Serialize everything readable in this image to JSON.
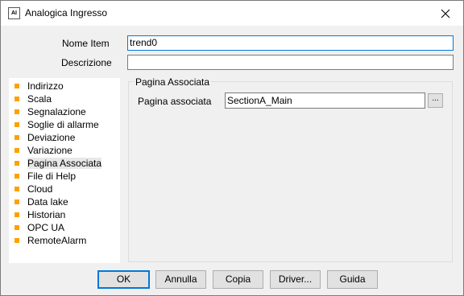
{
  "window": {
    "title": "Analogica Ingresso",
    "icon_label": "AI"
  },
  "form": {
    "name_label": "Nome Item",
    "name_value": "trend0",
    "description_label": "Descrizione",
    "description_value": ""
  },
  "sidebar": {
    "items": [
      {
        "label": "Indirizzo"
      },
      {
        "label": "Scala"
      },
      {
        "label": "Segnalazione"
      },
      {
        "label": "Soglie di allarme"
      },
      {
        "label": "Deviazione"
      },
      {
        "label": "Variazione"
      },
      {
        "label": "Pagina Associata",
        "selected": true
      },
      {
        "label": "File di Help"
      },
      {
        "label": "Cloud"
      },
      {
        "label": "Data lake"
      },
      {
        "label": "Historian"
      },
      {
        "label": "OPC UA"
      },
      {
        "label": "RemoteAlarm"
      }
    ],
    "bullet_color": "#ffa000"
  },
  "panel": {
    "group_title": "Pagina Associata",
    "page_label": "Pagina associata",
    "page_value": "SectionA_Main",
    "browse_label": "..."
  },
  "buttons": {
    "ok": "OK",
    "cancel": "Annulla",
    "copy": "Copia",
    "driver": "Driver...",
    "help": "Guida"
  },
  "colors": {
    "accent": "#0078d7",
    "dialog_bg": "#f0f0f0"
  }
}
